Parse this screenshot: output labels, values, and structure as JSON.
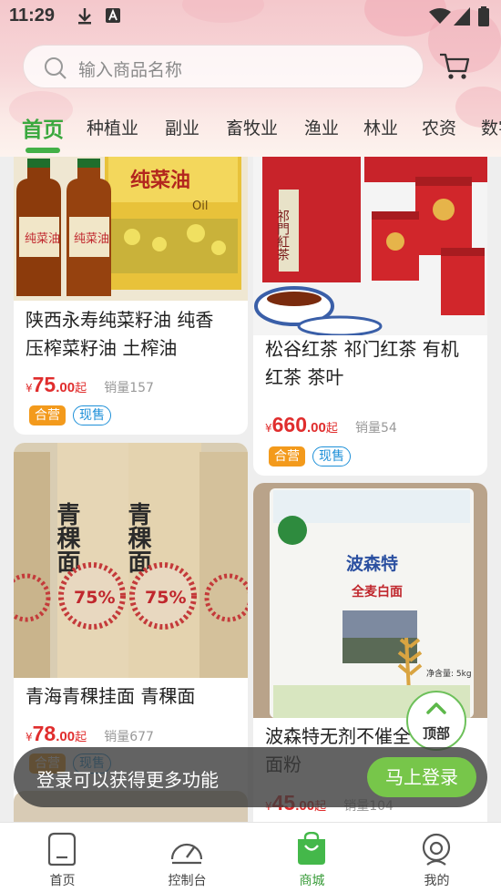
{
  "status_bar": {
    "time": "11:29"
  },
  "search": {
    "placeholder": "输入商品名称"
  },
  "tabs": [
    {
      "label": "首页",
      "active": true
    },
    {
      "label": "种植业"
    },
    {
      "label": "副业"
    },
    {
      "label": "畜牧业"
    },
    {
      "label": "渔业"
    },
    {
      "label": "林业"
    },
    {
      "label": "农资"
    },
    {
      "label": "数字"
    }
  ],
  "products": [
    {
      "title_line1": "陕西永寿纯菜籽油  纯香",
      "title_line2": "压榨菜籽油 土榨油",
      "price_int": "75",
      "price_dec": ".00",
      "price_symbol": "¥",
      "price_suffix": "起",
      "sales": "销量157",
      "badges": [
        "合营",
        "现售"
      ],
      "image_text": "纯菜油",
      "image_text2": "Oil"
    },
    {
      "title_line1": "松谷红茶 祁门红茶 有机",
      "title_line2": "红茶 茶叶",
      "price_int": "660",
      "price_dec": ".00",
      "price_symbol": "¥",
      "price_suffix": "起",
      "sales": "销量54",
      "badges": [
        "合营",
        "现售"
      ],
      "image_text": "祁門紅茶"
    },
    {
      "title_line1": "青海青稞挂面  青稞面",
      "title_line2": "",
      "price_int": "78",
      "price_dec": ".00",
      "price_symbol": "¥",
      "price_suffix": "起",
      "sales": "销量677",
      "badges": [
        "合营",
        "现售"
      ],
      "image_text": "青稞面",
      "image_text2": "75%"
    },
    {
      "title_line1": "波森特无剂不催全",
      "title_line2": "面粉",
      "price_int": "45",
      "price_dec": ".00",
      "price_symbol": "¥",
      "price_suffix": "起",
      "sales": "销量104",
      "badges": [],
      "image_text": "波森特",
      "image_text2": "全麦白面",
      "image_text3": "净含量: 5kg"
    }
  ],
  "float": {
    "top_label": "顶部"
  },
  "login_banner": {
    "text": "登录可以获得更多功能",
    "button": "马上登录"
  },
  "bottom_nav": [
    {
      "label": "首页"
    },
    {
      "label": "控制台"
    },
    {
      "label": "商城",
      "active": true
    },
    {
      "label": "我的"
    }
  ],
  "colors": {
    "accent": "#43b047",
    "price": "#e02d2d",
    "badge_orange": "#f39a1c",
    "badge_blue": "#1e90d8"
  }
}
